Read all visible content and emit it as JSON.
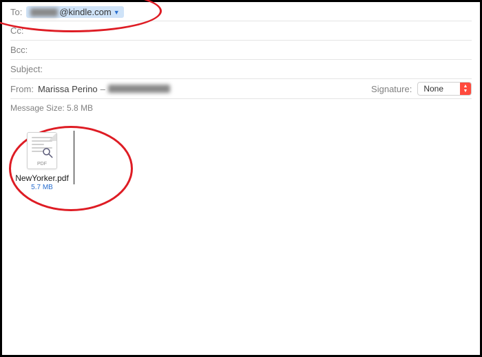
{
  "fields": {
    "to": {
      "label": "To:",
      "visibleSuffix": "@kindle.com"
    },
    "cc": {
      "label": "Cc:"
    },
    "bcc": {
      "label": "Bcc:"
    },
    "subject": {
      "label": "Subject:"
    },
    "from": {
      "label": "From:",
      "name": "Marissa Perino"
    }
  },
  "signature": {
    "label": "Signature:",
    "selected": "None"
  },
  "messageSize": {
    "label": "Message Size:",
    "value": "5.8 MB"
  },
  "attachment": {
    "iconLabel": "PDF",
    "filename": "NewYorker.pdf",
    "size": "5.7 MB"
  }
}
